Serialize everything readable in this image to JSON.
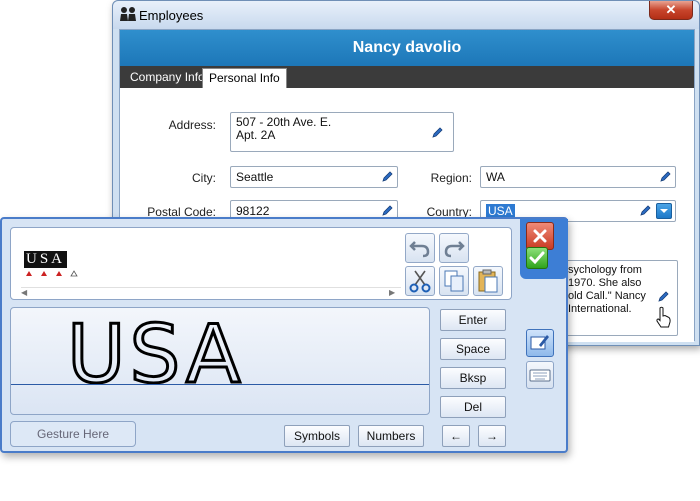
{
  "employees_window": {
    "title": "Employees",
    "close_label": "✕",
    "employee_name": "Nancy davolio",
    "tabs": [
      {
        "label": "Company Info",
        "selected": false
      },
      {
        "label": "Personal Info",
        "selected": true
      }
    ],
    "form": {
      "address_label": "Address:",
      "address_line1": "507 - 20th Ave. E.",
      "address_line2": "Apt. 2A",
      "city_label": "City:",
      "city_value": "Seattle",
      "region_label": "Region:",
      "region_value": "WA",
      "postal_label": "Postal Code:",
      "postal_value": "98122",
      "country_label": "Country:",
      "country_value": "USA",
      "notes_lines": [
        "sychology from",
        "1970.  She also",
        "old Call.\"  Nancy",
        " International."
      ]
    }
  },
  "ink_panel": {
    "recognized_text": "USA",
    "handwriting": "USA",
    "buttons": {
      "enter": "Enter",
      "space": "Space",
      "bksp": "Bksp",
      "del": "Del",
      "symbols": "Symbols",
      "numbers": "Numbers",
      "left": "←",
      "right": "→"
    },
    "gesture_placeholder": "Gesture Here",
    "icons": [
      "undo-icon",
      "redo-icon",
      "cut-icon",
      "copy-icon",
      "paste-icon",
      "cancel-icon",
      "accept-icon",
      "ink-mode-icon",
      "keyboard-icon"
    ]
  },
  "colors": {
    "header_blue": "#2586c6",
    "tab_strip": "#3b3b3b",
    "panel_border": "#4a7cc9",
    "selection": "#2d7ad2"
  }
}
